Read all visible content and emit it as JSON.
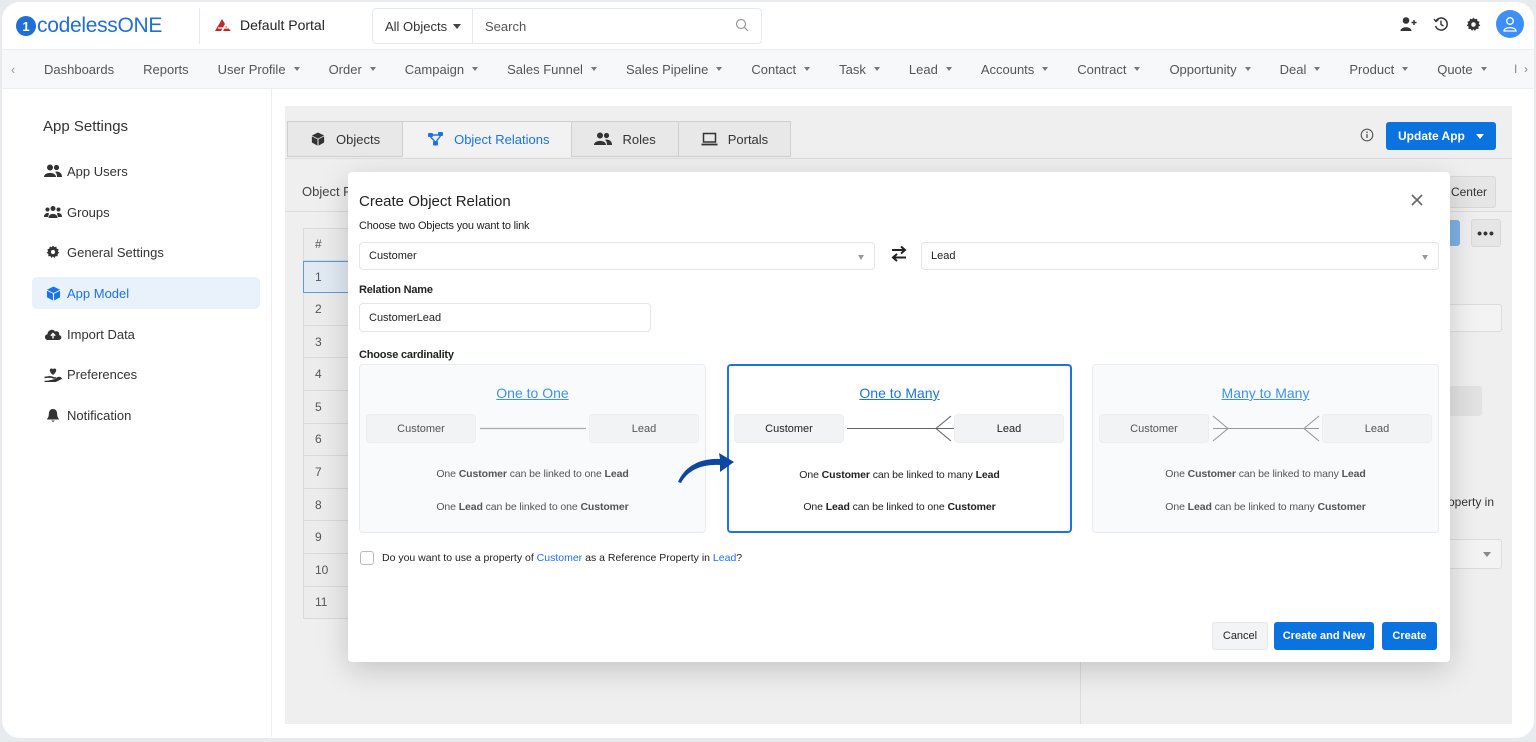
{
  "app": {
    "logo_mark": "1",
    "logo_text": "codelessONE",
    "portal_name": "Default Portal"
  },
  "search": {
    "scope": "All Objects",
    "placeholder": "Search"
  },
  "top_icons": [
    "add-user-icon",
    "history-icon",
    "settings-icon",
    "user-avatar-icon"
  ],
  "nav": {
    "items": [
      {
        "label": "Dashboards",
        "dropdown": false
      },
      {
        "label": "Reports",
        "dropdown": false
      },
      {
        "label": "User Profile",
        "dropdown": true
      },
      {
        "label": "Order",
        "dropdown": true
      },
      {
        "label": "Campaign",
        "dropdown": true
      },
      {
        "label": "Sales Funnel",
        "dropdown": true
      },
      {
        "label": "Sales Pipeline",
        "dropdown": true
      },
      {
        "label": "Contact",
        "dropdown": true
      },
      {
        "label": "Task",
        "dropdown": true
      },
      {
        "label": "Lead",
        "dropdown": true
      },
      {
        "label": "Accounts",
        "dropdown": true
      },
      {
        "label": "Contract",
        "dropdown": true
      },
      {
        "label": "Opportunity",
        "dropdown": true
      },
      {
        "label": "Deal",
        "dropdown": true
      },
      {
        "label": "Product",
        "dropdown": true
      },
      {
        "label": "Quote",
        "dropdown": true
      }
    ],
    "overflow": "I"
  },
  "sidebar": {
    "title": "App Settings",
    "items": [
      {
        "label": "App Users",
        "icon": "users-icon",
        "active": false
      },
      {
        "label": "Groups",
        "icon": "groups-icon",
        "active": false
      },
      {
        "label": "General Settings",
        "icon": "gear-icon",
        "active": false
      },
      {
        "label": "App Model",
        "icon": "cube-icon",
        "active": true
      },
      {
        "label": "Import Data",
        "icon": "cloud-upload-icon",
        "active": false
      },
      {
        "label": "Preferences",
        "icon": "preferences-icon",
        "active": false
      },
      {
        "label": "Notification",
        "icon": "bell-icon",
        "active": false
      }
    ]
  },
  "main": {
    "tabs": [
      {
        "label": "Objects",
        "active": false
      },
      {
        "label": "Object Relations",
        "active": true
      },
      {
        "label": "Roles",
        "active": false
      },
      {
        "label": "Portals",
        "active": false
      }
    ],
    "update_button": "Update App",
    "section_label": "Object R",
    "help_button_partial": "Center",
    "more_button": "•••",
    "row_header": "#",
    "rows": [
      "1",
      "2",
      "3",
      "4",
      "5",
      "6",
      "7",
      "8",
      "9",
      "10",
      "11"
    ],
    "selected_row": "1",
    "right_panel_partial_text": "operty in"
  },
  "modal": {
    "title": "Create Object Relation",
    "choose_objects_label": "Choose two Objects you want to link",
    "object_a": "Customer",
    "object_b": "Lead",
    "relation_name_label": "Relation Name",
    "relation_name_value": "CustomerLead",
    "cardinality_label": "Choose cardinality",
    "selected_cardinality": "One to Many",
    "cards": [
      {
        "title": "One to One",
        "left": "Customer",
        "right": "Lead",
        "line1": {
          "pre": "One ",
          "a": "Customer",
          "mid": " can be linked to one ",
          "b": "Lead"
        },
        "line2": {
          "pre": "One ",
          "a": "Lead",
          "mid": " can be linked to one ",
          "b": "Customer"
        }
      },
      {
        "title": "One to Many",
        "left": "Customer",
        "right": "Lead",
        "line1": {
          "pre": "One ",
          "a": "Customer",
          "mid": " can be linked to many ",
          "b": "Lead"
        },
        "line2": {
          "pre": "One ",
          "a": "Lead",
          "mid": " can be linked to one ",
          "b": "Customer"
        }
      },
      {
        "title": "Many to Many",
        "left": "Customer",
        "right": "Lead",
        "line1": {
          "pre": "One ",
          "a": "Customer",
          "mid": " can be linked to many ",
          "b": "Lead"
        },
        "line2": {
          "pre": "One ",
          "a": "Lead",
          "mid": " can be linked to many ",
          "b": "Customer"
        }
      }
    ],
    "reference": {
      "checked": false,
      "pre": "Do you want to use a property of ",
      "a": "Customer",
      "mid": " as a Reference Property in ",
      "b": "Lead",
      "post": "?"
    },
    "buttons": {
      "cancel": "Cancel",
      "create_and_new": "Create and New",
      "create": "Create"
    }
  },
  "colors": {
    "accent": "#1a73e8",
    "primary_button": "#0b73e0",
    "logo": "#1f6fd6",
    "pointer_arrow": "#0d47a1"
  }
}
